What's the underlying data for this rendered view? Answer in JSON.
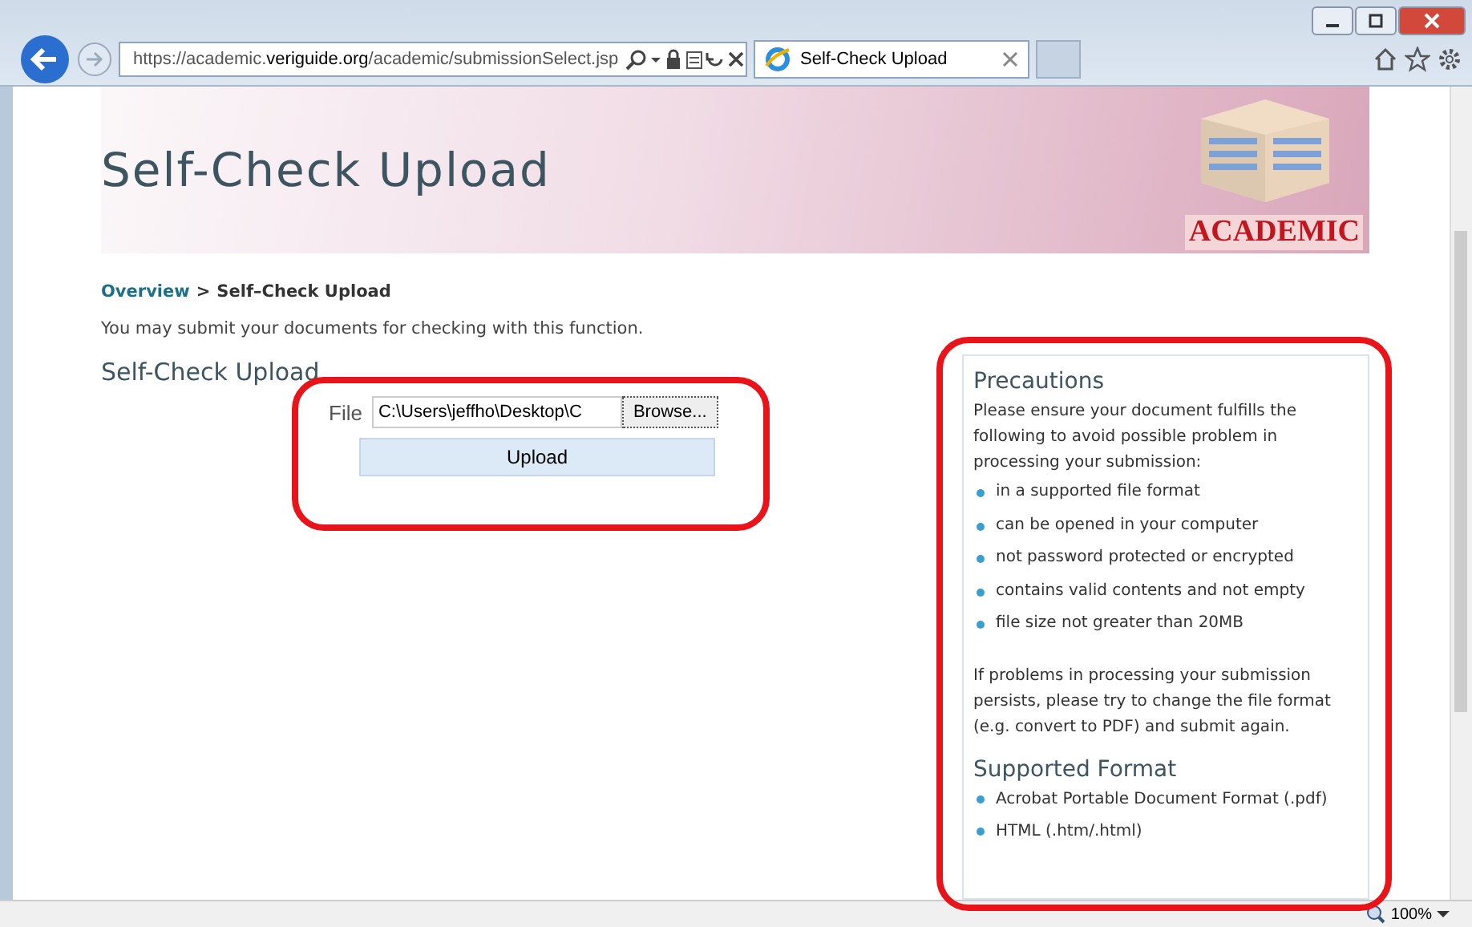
{
  "browser": {
    "url_parts": [
      {
        "text": "https://",
        "kind": "dim"
      },
      {
        "text": "academic.",
        "kind": "dim"
      },
      {
        "text": "veriguide.org",
        "kind": "strong"
      },
      {
        "text": "/academic/submissionSelect.jsp",
        "kind": "dim"
      }
    ],
    "tab_title": "Self-Check Upload",
    "zoom": "100%"
  },
  "banner": {
    "title": "Self-Check Upload",
    "logo_text": "ACADEMIC"
  },
  "breadcrumb": {
    "link": "Overview",
    "separator": ">",
    "current": "Self–Check Upload"
  },
  "intro": "You may submit your documents for checking with this function.",
  "section_title": "Self-Check Upload",
  "form": {
    "label": "File",
    "value": "C:\\Users\\jeffho\\Desktop\\C",
    "browse": "Browse...",
    "upload": "Upload"
  },
  "precautions": {
    "title": "Precautions",
    "intro": "Please ensure your document fulfills the following to avoid possible problem in processing your submission:",
    "items": [
      "in a supported file format",
      "can be opened in your computer",
      "not password protected or encrypted",
      "contains valid contents and not empty",
      "file size not greater than 20MB"
    ],
    "note": "If problems in processing your submission persists, please try to change the file format (e.g. convert to PDF) and submit again."
  },
  "formats": {
    "title": "Supported Format",
    "items": [
      "Acrobat Portable Document Format (.pdf)",
      "HTML (.htm/.html)"
    ]
  }
}
